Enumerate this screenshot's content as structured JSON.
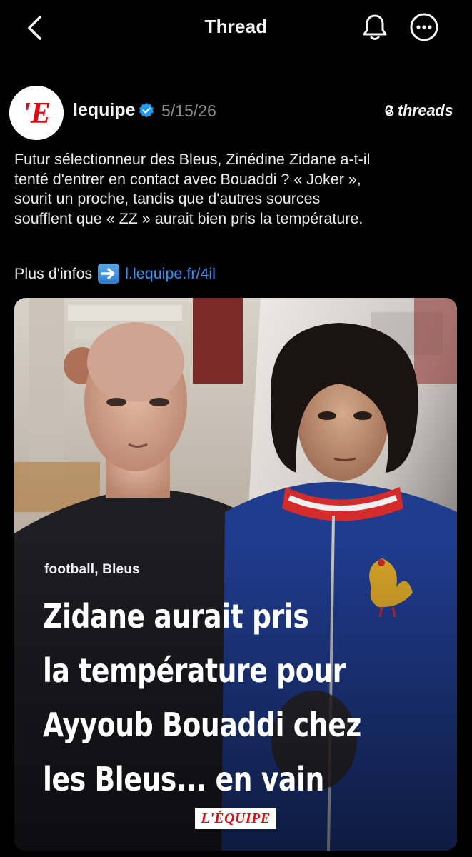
{
  "header": {
    "title": "Thread",
    "back_icon": "chevron-left-icon",
    "notify_icon": "bell-icon",
    "more_icon": "more-horizontal-icon"
  },
  "post": {
    "username": "lequipe",
    "date": "5/15/26",
    "brand": "threads",
    "text_lines": [
      "Futur sélectionneur des Bleus, Zinédine Zidane a-t-il",
      "tenté d'entrer en contact avec Bouaddi ? « Joker »,",
      "sourit un proche, tandis que d'autres sources",
      "soufflent que « ZZ » aurait bien pris la température."
    ],
    "more_info_label": "Plus d'infos",
    "link": "l.lequipe.fr/4il",
    "avatar_letter": "'E"
  },
  "card": {
    "tags": "football, Bleus",
    "headline_lines": [
      "Zidane aurait pris",
      "la température pour",
      "Ayyoub Bouaddi chez",
      "les Bleus... en vain"
    ],
    "badge": "L'ÉQUIPE"
  },
  "colors": {
    "background": "#000000",
    "link": "#3d8ef0",
    "verified": "#1d9bf0",
    "lequipe_red": "#e30613"
  }
}
